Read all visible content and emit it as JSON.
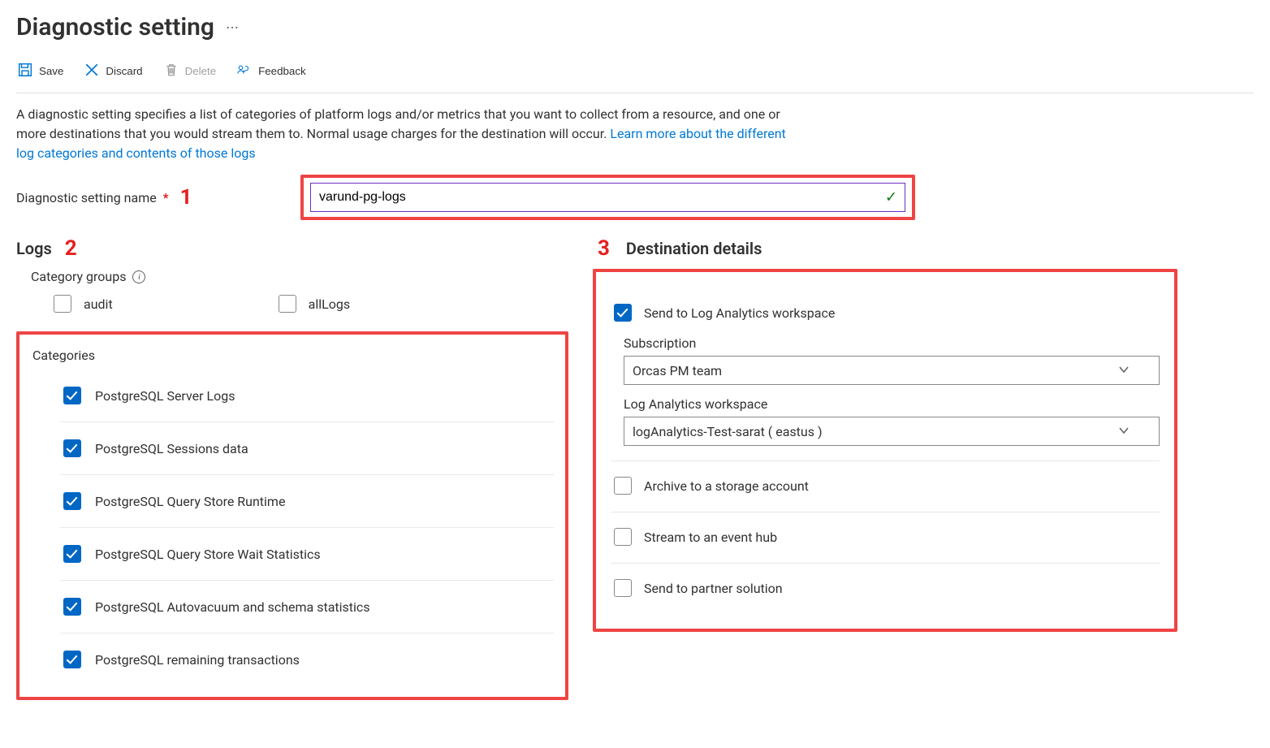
{
  "header": {
    "title": "Diagnostic setting"
  },
  "toolbar": {
    "save": "Save",
    "discard": "Discard",
    "delete": "Delete",
    "feedback": "Feedback"
  },
  "description": {
    "text": "A diagnostic setting specifies a list of categories of platform logs and/or metrics that you want to collect from a resource, and one or more destinations that you would stream them to. Normal usage charges for the destination will occur. ",
    "link": "Learn more about the different log categories and contents of those logs"
  },
  "name_field": {
    "label": "Diagnostic setting name",
    "value": "varund-pg-logs"
  },
  "callouts": {
    "n1": "1",
    "n2": "2",
    "n3": "3"
  },
  "logs": {
    "title": "Logs",
    "category_groups_label": "Category groups",
    "groups": {
      "audit": "audit",
      "allLogs": "allLogs"
    },
    "categories_label": "Categories",
    "categories": [
      "PostgreSQL Server Logs",
      "PostgreSQL Sessions data",
      "PostgreSQL Query Store Runtime",
      "PostgreSQL Query Store Wait Statistics",
      "PostgreSQL Autovacuum and schema statistics",
      "PostgreSQL remaining transactions"
    ]
  },
  "destination": {
    "title": "Destination details",
    "log_analytics": "Send to Log Analytics workspace",
    "subscription_label": "Subscription",
    "subscription_value": "Orcas PM team",
    "workspace_label": "Log Analytics workspace",
    "workspace_value": "logAnalytics-Test-sarat ( eastus )",
    "storage": "Archive to a storage account",
    "eventhub": "Stream to an event hub",
    "partner": "Send to partner solution"
  }
}
